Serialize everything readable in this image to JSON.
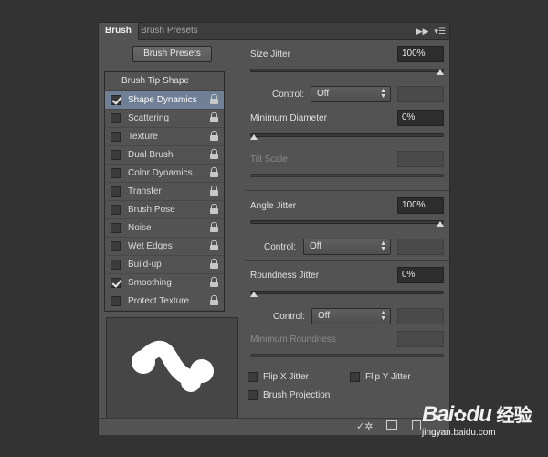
{
  "tabs": {
    "brush": "Brush",
    "presets": "Brush Presets"
  },
  "presets_button": "Brush Presets",
  "list": {
    "header": "Brush Tip Shape",
    "items": [
      {
        "label": "Shape Dynamics",
        "checked": true,
        "selected": true
      },
      {
        "label": "Scattering",
        "checked": false
      },
      {
        "label": "Texture",
        "checked": false
      },
      {
        "label": "Dual Brush",
        "checked": false
      },
      {
        "label": "Color Dynamics",
        "checked": false
      },
      {
        "label": "Transfer",
        "checked": false
      },
      {
        "label": "Brush Pose",
        "checked": false
      },
      {
        "label": "Noise",
        "checked": false
      },
      {
        "label": "Wet Edges",
        "checked": false
      },
      {
        "label": "Build-up",
        "checked": false
      },
      {
        "label": "Smoothing",
        "checked": true
      },
      {
        "label": "Protect Texture",
        "checked": false
      }
    ]
  },
  "settings": {
    "size_jitter": {
      "label": "Size Jitter",
      "value": "100%",
      "level": 1.0
    },
    "control1": {
      "label": "Control:",
      "value": "Off"
    },
    "min_diameter": {
      "label": "Minimum Diameter",
      "value": "0%",
      "level": 0.0
    },
    "tilt_scale": {
      "label": "Tilt Scale"
    },
    "angle_jitter": {
      "label": "Angle Jitter",
      "value": "100%",
      "level": 1.0
    },
    "control2": {
      "label": "Control:",
      "value": "Off"
    },
    "roundness_jitter": {
      "label": "Roundness Jitter",
      "value": "0%",
      "level": 0.0
    },
    "control3": {
      "label": "Control:",
      "value": "Off"
    },
    "min_roundness": {
      "label": "Minimum Roundness"
    },
    "flip_x": {
      "label": "Flip X Jitter"
    },
    "flip_y": {
      "label": "Flip Y Jitter"
    },
    "projection": {
      "label": "Brush Projection"
    }
  },
  "watermark": {
    "brand": "Bai",
    "brand2": "du",
    "cn": "经验",
    "url": "jingyan.baidu.com"
  }
}
